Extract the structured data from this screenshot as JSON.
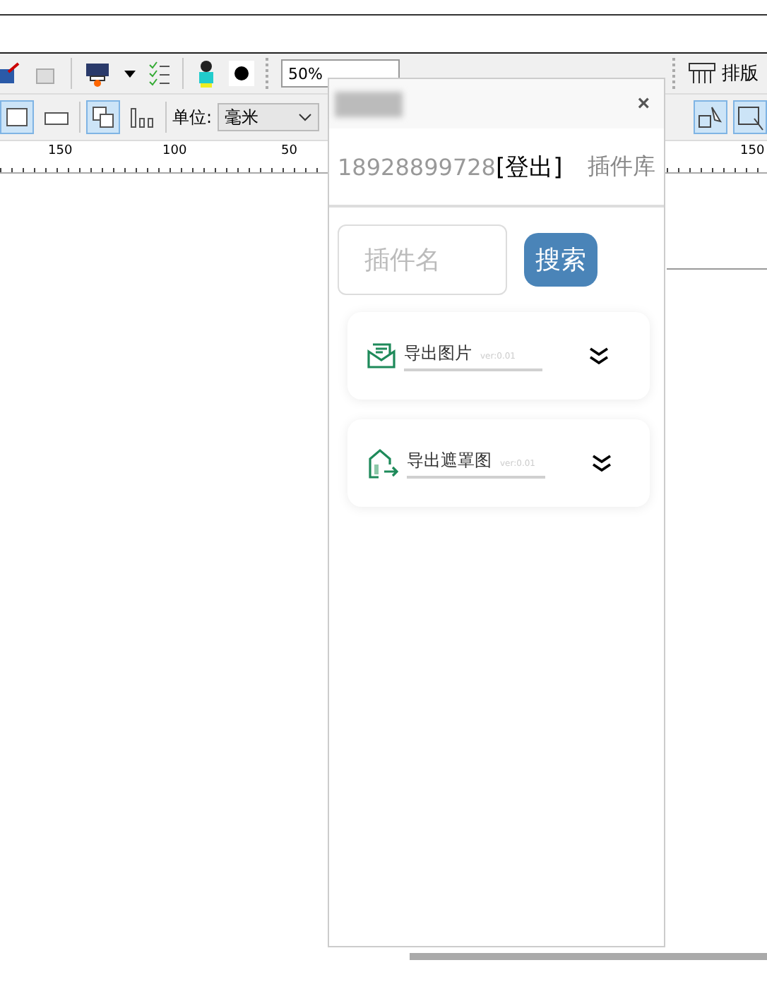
{
  "toolbar": {
    "zoom": "50%",
    "layout_button": "排版"
  },
  "property_bar": {
    "unit_label": "单位:",
    "unit_value": "毫米",
    "buttons": [
      {
        "selected": true
      },
      {
        "selected": false
      },
      {
        "selected": true
      },
      {
        "selected": false
      }
    ]
  },
  "ruler": {
    "labels": [
      "150",
      "100",
      "50",
      "150"
    ]
  },
  "panel": {
    "close": "×",
    "account": "18928899728",
    "logout": "[登出]",
    "library": "插件库",
    "search": {
      "placeholder": "插件名",
      "button": "搜索"
    },
    "plugins": [
      {
        "name": "导出图片",
        "version": "ver:0.01",
        "kind": "envelope"
      },
      {
        "name": "导出遮罩图",
        "version": "ver:0.01",
        "kind": "house"
      }
    ]
  }
}
